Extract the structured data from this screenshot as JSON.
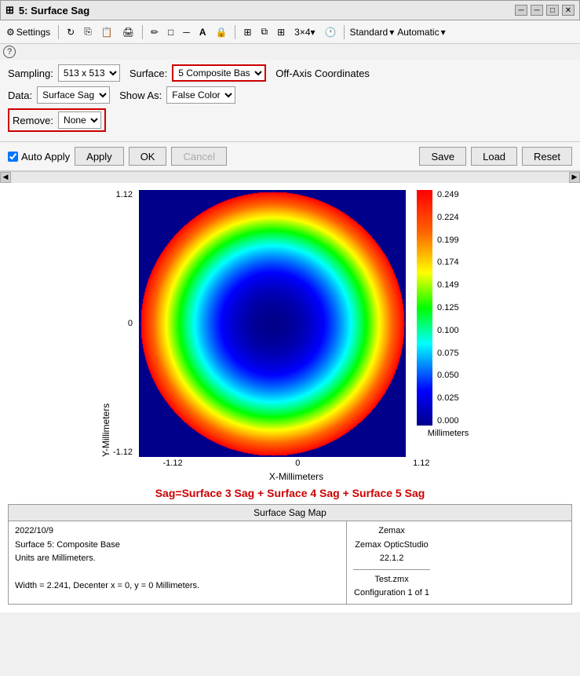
{
  "titleBar": {
    "title": "5: Surface Sag",
    "controls": [
      "pin",
      "minimize",
      "maximize",
      "close"
    ]
  },
  "toolbar": {
    "items": [
      "Settings",
      "Reload",
      "Copy",
      "Print",
      "Pencil",
      "Rectangle",
      "Line",
      "Text",
      "Lock",
      "Grid",
      "Layers",
      "Matrix",
      "3 x 4",
      "Clock"
    ],
    "dropdowns": [
      "Standard",
      "Automatic"
    ]
  },
  "controls": {
    "samplingLabel": "Sampling:",
    "samplingValue": "513 x 513",
    "dataLabel": "Data:",
    "dataValue": "Surface Sag",
    "surfaceLabel": "Surface:",
    "surfaceValue": "5 Composite Bas",
    "showAsLabel": "Show As:",
    "showAsValue": "False Color",
    "removeLabel": "Remove:",
    "removeValue": "None",
    "offAxisLabel": "Off-Axis Coordinates"
  },
  "buttons": {
    "autoApplyLabel": "Auto Apply",
    "applyLabel": "Apply",
    "okLabel": "OK",
    "cancelLabel": "Cancel",
    "saveLabel": "Save",
    "loadLabel": "Load",
    "resetLabel": "Reset"
  },
  "chart": {
    "yAxisLabel": "Y-Millimeters",
    "xAxisLabel": "X-Millimeters",
    "yTicks": [
      "1.12",
      "",
      "0",
      "",
      "-1.12"
    ],
    "xTicks": [
      "-1.12",
      "0",
      "1.12"
    ],
    "colorbarValues": [
      "0.249",
      "0.224",
      "0.199",
      "0.174",
      "0.149",
      "0.125",
      "0.100",
      "0.075",
      "0.050",
      "0.025",
      "0.000"
    ],
    "colorbarUnit": "Millimeters"
  },
  "formula": "Sag=Surface 3 Sag + Surface 4 Sag + Surface 5 Sag",
  "infoTable": {
    "header": "Surface Sag Map",
    "leftContent": "2022/10/9\nSurface 5: Composite Base\nUnits are Millimeters.\n\nWidth = 2.241, Decenter x = 0, y = 0 Millimeters.",
    "rightTop": "Zemax\nZemax OpticStudio 22.1.2",
    "rightBottom": "Test.zmx\nConfiguration 1 of 1"
  }
}
